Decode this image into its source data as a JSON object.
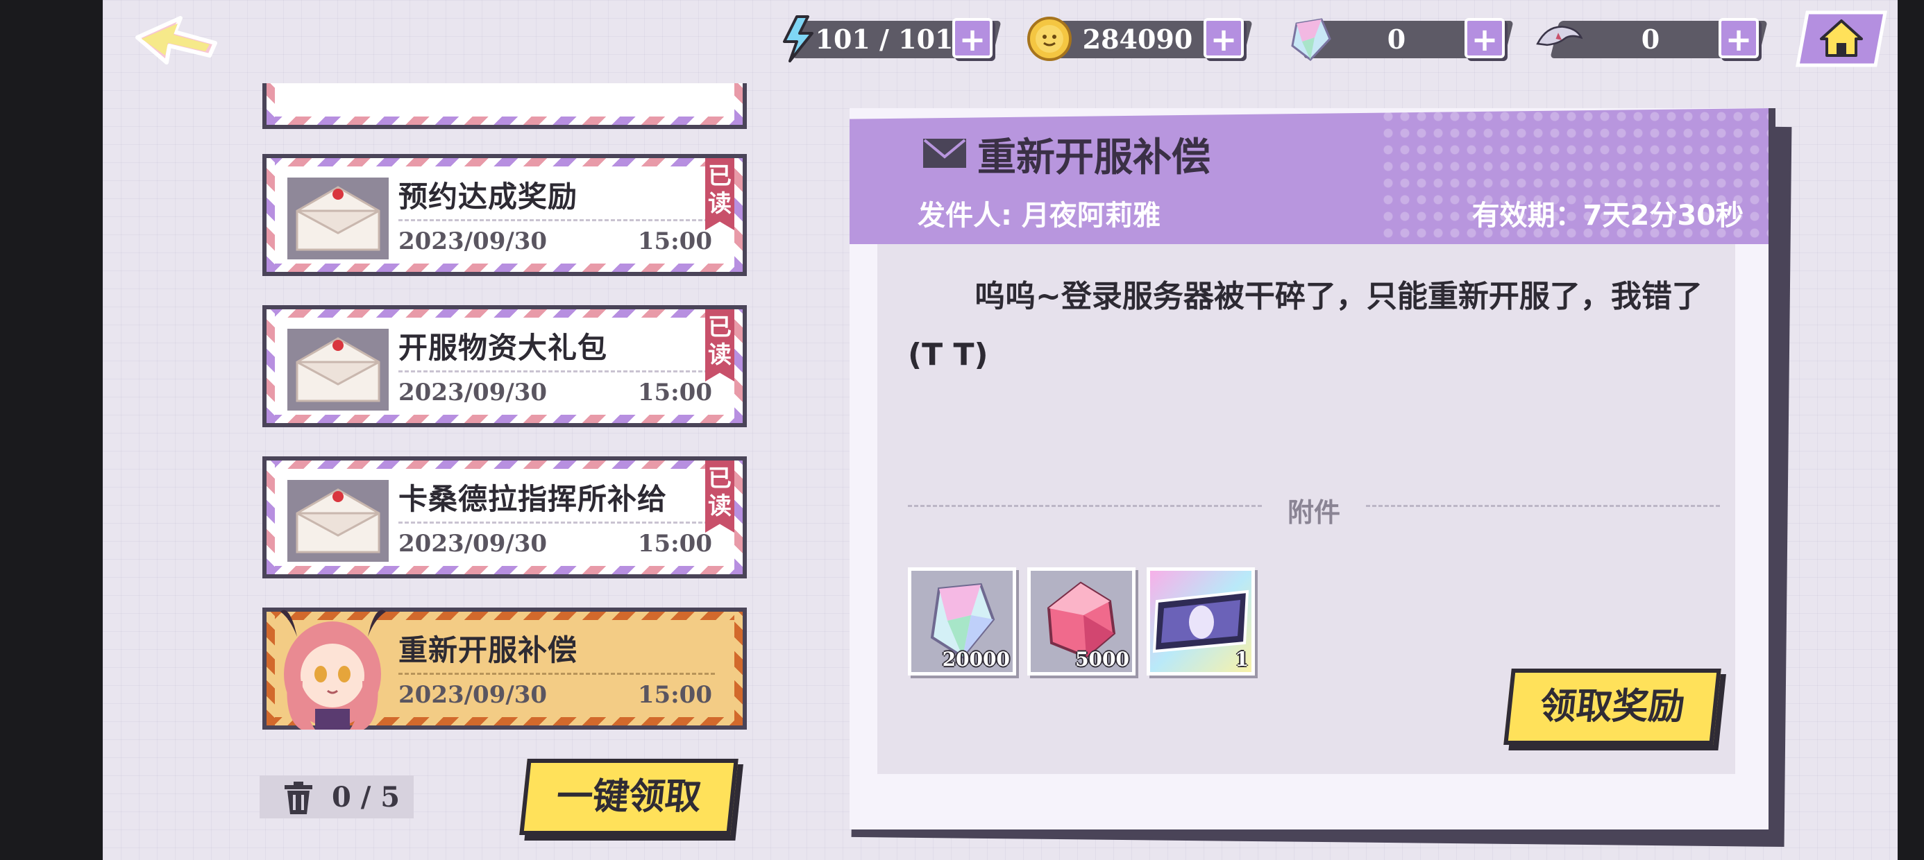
{
  "topbar": {
    "energy": {
      "value": "101 / 101",
      "icon": "lightning-icon"
    },
    "coins": {
      "value": "284090",
      "icon": "coin-icon"
    },
    "crystals": {
      "value": "0",
      "icon": "crystal-icon"
    },
    "wings": {
      "value": "0",
      "icon": "wing-icon"
    },
    "plus": "+"
  },
  "mails": [
    {
      "title": "预约达成奖励",
      "date": "2023/09/30",
      "time": "15:00",
      "read_tag": "已读"
    },
    {
      "title": "开服物资大礼包",
      "date": "2023/09/30",
      "time": "15:00",
      "read_tag": "已读"
    },
    {
      "title": "卡桑德拉指挥所补给",
      "date": "2023/09/30",
      "time": "15:00",
      "read_tag": "已读"
    },
    {
      "title": "重新开服补偿",
      "date": "2023/09/30",
      "time": "15:00"
    }
  ],
  "trash": {
    "count": "0 / 5"
  },
  "claim_all_label": "一键领取",
  "detail": {
    "title": "重新开服补偿",
    "sender": "发件人: 月夜阿莉雅",
    "validity": "有效期：7天2分30秒",
    "body": "呜呜~登录服务器被干碎了，只能重新开服了，我错了 (T    T)",
    "attachments_label": "附件",
    "attachments": [
      {
        "icon": "crystal-icon",
        "qty": "20000"
      },
      {
        "icon": "pink-gem-icon",
        "qty": "5000"
      },
      {
        "icon": "ticket-card-icon",
        "qty": "1"
      }
    ],
    "claim_label": "领取奖励"
  },
  "colors": {
    "accent_purple": "#b896de",
    "button_yellow": "#ffe15a",
    "read_tag": "#c8506a",
    "dark": "#4a4458"
  }
}
